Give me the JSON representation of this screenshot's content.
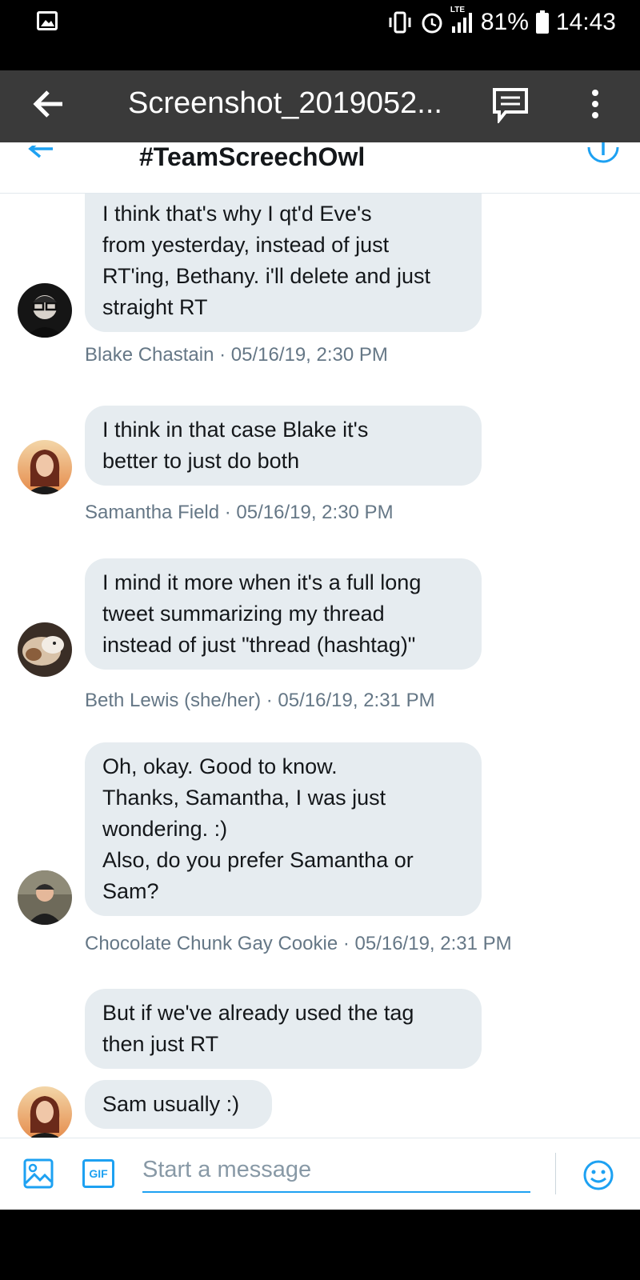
{
  "status_bar": {
    "signal_label": "LTE",
    "battery_percent": "81%",
    "time": "14:43"
  },
  "viewer": {
    "title": "Screenshot_2019052..."
  },
  "conversation": {
    "title": "#TeamScreechOwl"
  },
  "messages": [
    {
      "text": "I think that's why I qt'd Eve's\nfrom yesterday, instead of just\nRT'ing, Bethany. i'll delete and just\nstraight RT",
      "meta": "Blake Chastain · 05/16/19, 2:30 PM"
    },
    {
      "text": "I think in that case Blake it's\nbetter to just do both",
      "meta": "Samantha Field · 05/16/19, 2:30 PM"
    },
    {
      "text": "I mind it more when it's a full long\ntweet summarizing my thread\ninstead of just \"thread (hashtag)\"",
      "meta": "Beth Lewis (she/her) · 05/16/19, 2:31 PM"
    },
    {
      "text": "Oh, okay. Good to know.\nThanks, Samantha, I was just\nwondering. :)\nAlso, do you prefer Samantha or\nSam?",
      "meta": "Chocolate Chunk Gay Cookie · 05/16/19, 2:31 PM"
    },
    {
      "text": "But if we've already used the tag\nthen just RT"
    },
    {
      "text": "Sam usually :)"
    }
  ],
  "composer": {
    "placeholder": "Start a message",
    "gif_label": "GIF"
  },
  "colors": {
    "accent": "#1da1f2",
    "bubble": "#e6ecf0",
    "meta_text": "#657786",
    "viewer_bar": "#3a3a3a"
  }
}
